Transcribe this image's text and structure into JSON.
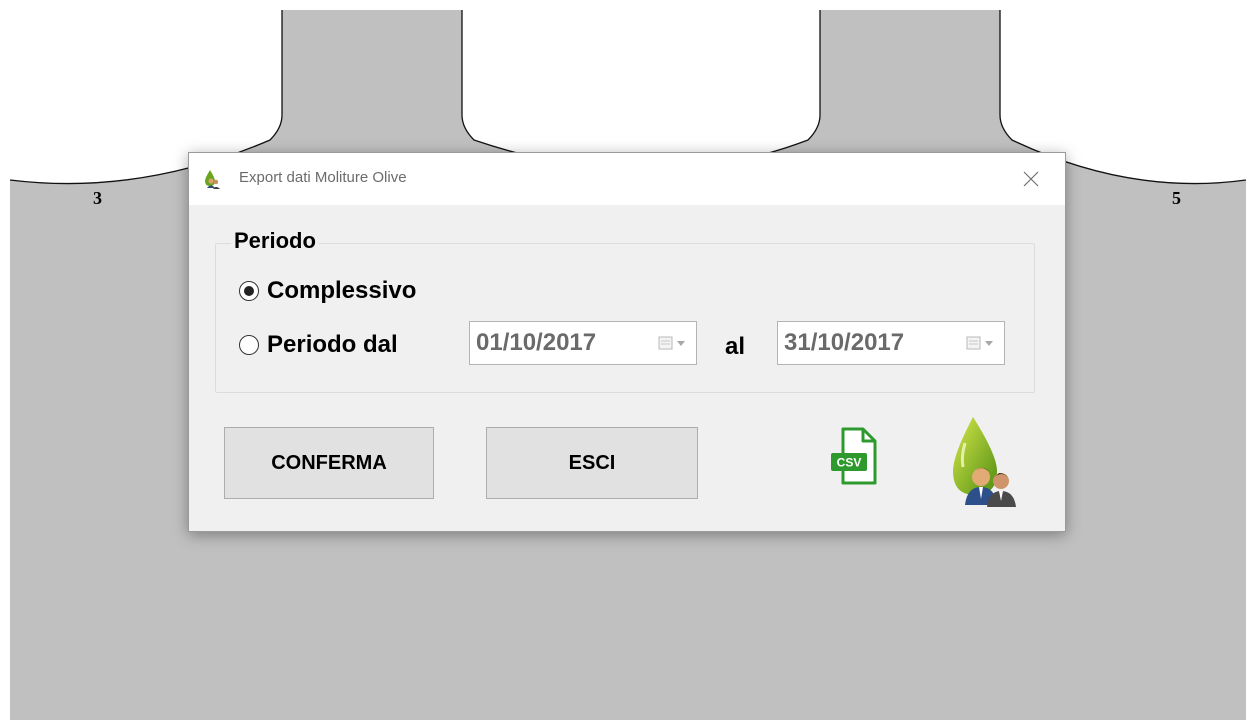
{
  "background": {
    "lane_labels": [
      "3",
      "5"
    ],
    "fill_color": "#c0c0c0"
  },
  "dialog": {
    "title": "Export dati Moliture Olive",
    "title_icon": "olive-drop-people-icon",
    "close_icon": "close-icon",
    "group_title": "Periodo",
    "options": [
      {
        "label": "Complessivo",
        "selected": true
      },
      {
        "label": "Periodo dal",
        "selected": false
      }
    ],
    "date_from": "01/10/2017",
    "between_label": "al",
    "date_to": "31/10/2017",
    "confirm_label": "CONFERMA",
    "exit_label": "ESCI",
    "csv_icon": "csv-file-icon",
    "logo_icon": "olive-drop-people-icon",
    "csv_badge": "CSV"
  }
}
